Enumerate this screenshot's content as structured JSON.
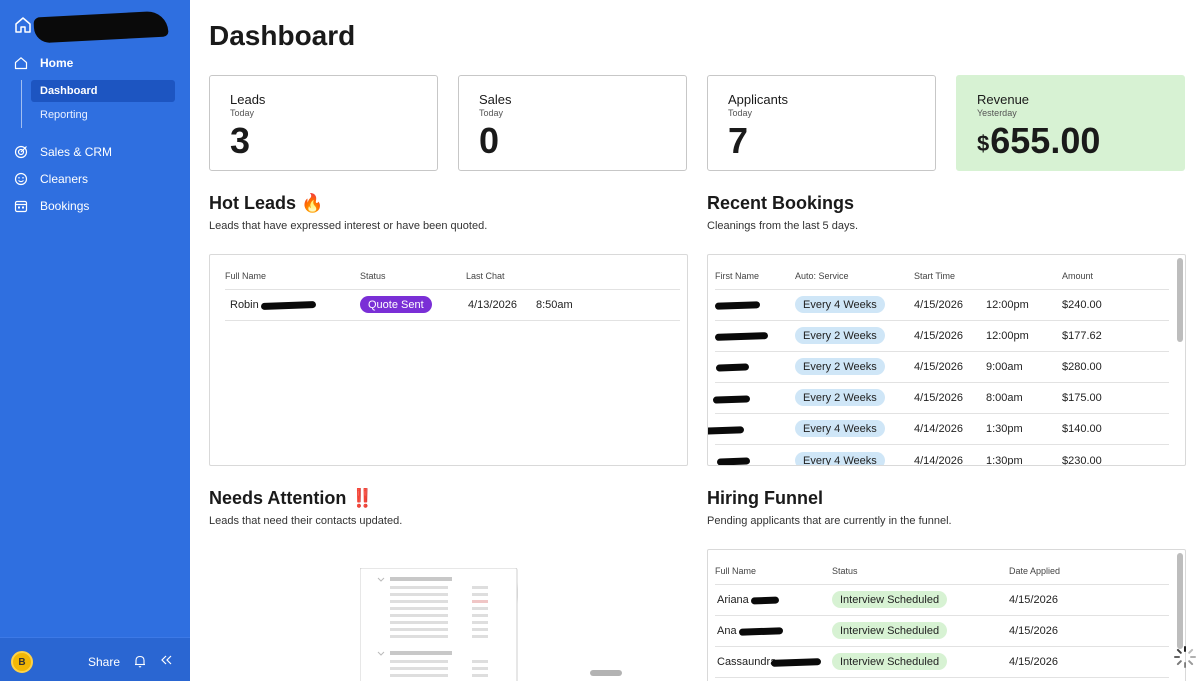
{
  "sidebar": {
    "items": [
      {
        "label": "Home",
        "icon": "home-outline-icon"
      },
      {
        "label": "Sales & CRM",
        "icon": "target-icon"
      },
      {
        "label": "Cleaners",
        "icon": "smiley-icon"
      },
      {
        "label": "Bookings",
        "icon": "calendar-icon"
      }
    ],
    "subitems": [
      {
        "label": "Dashboard",
        "active": true
      },
      {
        "label": "Reporting",
        "active": false
      }
    ],
    "avatar_initial": "B",
    "share_label": "Share"
  },
  "page": {
    "title": "Dashboard"
  },
  "stats": [
    {
      "title": "Leads",
      "subtitle": "Today",
      "value": "3"
    },
    {
      "title": "Sales",
      "subtitle": "Today",
      "value": "0"
    },
    {
      "title": "Applicants",
      "subtitle": "Today",
      "value": "7"
    },
    {
      "title": "Revenue",
      "subtitle": "Yesterday",
      "currency": "$",
      "value": "655.00"
    }
  ],
  "hot_leads": {
    "title": "Hot Leads 🔥",
    "subtitle": "Leads that have expressed interest or have been quoted.",
    "columns": [
      "Full Name",
      "Status",
      "Last Chat"
    ],
    "rows": [
      {
        "name": "Robin",
        "status": "Quote Sent",
        "date": "4/13/2026",
        "time": "8:50am"
      }
    ]
  },
  "recent_bookings": {
    "title": "Recent Bookings",
    "subtitle": "Cleanings from the last 5 days.",
    "columns": [
      "First Name",
      "Auto: Service",
      "Start Time",
      "Amount"
    ],
    "rows": [
      {
        "service": "Every 4 Weeks",
        "date": "4/15/2026",
        "time": "12:00pm",
        "amount": "$240.00"
      },
      {
        "service": "Every 2 Weeks",
        "date": "4/15/2026",
        "time": "12:00pm",
        "amount": "$177.62"
      },
      {
        "service": "Every 2 Weeks",
        "date": "4/15/2026",
        "time": "9:00am",
        "amount": "$280.00"
      },
      {
        "service": "Every 2 Weeks",
        "date": "4/15/2026",
        "time": "8:00am",
        "amount": "$175.00"
      },
      {
        "service": "Every 4 Weeks",
        "date": "4/14/2026",
        "time": "1:30pm",
        "amount": "$140.00"
      },
      {
        "service": "Every 4 Weeks",
        "date": "4/14/2026",
        "time": "1:30pm",
        "amount": "$230.00"
      }
    ]
  },
  "needs_attention": {
    "title": "Needs Attention ‼️",
    "subtitle": "Leads that need their contacts updated."
  },
  "hiring_funnel": {
    "title": "Hiring Funnel",
    "subtitle": "Pending applicants that are currently in the funnel.",
    "columns": [
      "Full Name",
      "Status",
      "Date Applied"
    ],
    "rows": [
      {
        "name": "Ariana",
        "status": "Interview Scheduled",
        "date": "4/15/2026"
      },
      {
        "name": "Ana",
        "status": "Interview Scheduled",
        "date": "4/15/2026"
      },
      {
        "name": "Cassaundra",
        "status": "Interview Scheduled",
        "date": "4/15/2026"
      }
    ]
  },
  "colors": {
    "sidebar_bg": "#2f6fe0",
    "revenue_card_bg": "#d7f2d3",
    "quote_sent_pill": "#7a2fd6",
    "service_pill": "#cfe6f7",
    "interview_pill": "#d7f2d3"
  }
}
